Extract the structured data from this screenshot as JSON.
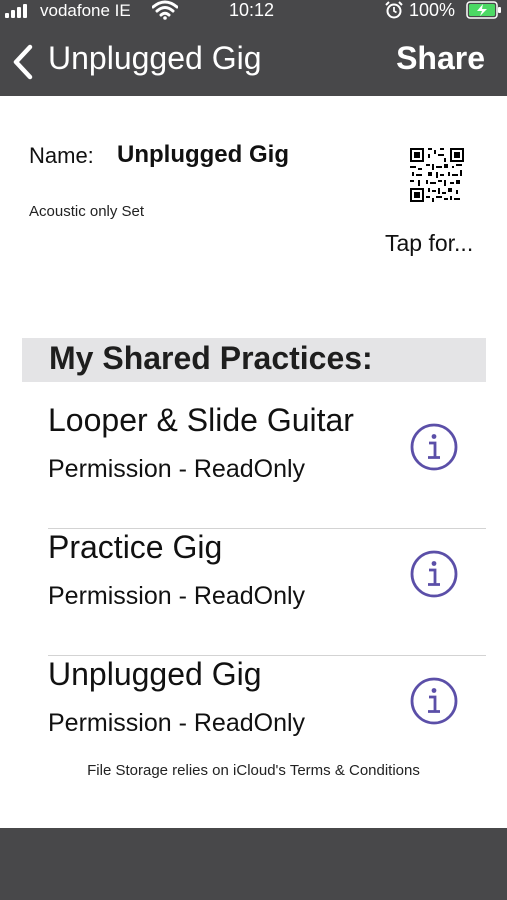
{
  "status_bar": {
    "carrier": "vodafone IE",
    "time": "10:12",
    "battery_percent": "100%",
    "icons": [
      "signal-bars-icon",
      "wifi-icon",
      "alarm-icon",
      "battery-charging-icon"
    ]
  },
  "nav": {
    "back_icon": "chevron-left-icon",
    "title": "Unplugged Gig",
    "share_label": "Share"
  },
  "info": {
    "name_label": "Name:",
    "name_value": "Unplugged Gig",
    "description": "Acoustic only Set",
    "qr_caption": "Tap for..."
  },
  "shared": {
    "title": "My Shared Practices:",
    "items": [
      {
        "title": "Looper & Slide Guitar",
        "permission": "Permission - ReadOnly"
      },
      {
        "title": "Practice Gig",
        "permission": "Permission - ReadOnly"
      },
      {
        "title": "Unplugged Gig",
        "permission": "Permission - ReadOnly"
      }
    ]
  },
  "footer": {
    "note": "File Storage relies on iCloud's Terms & Conditions"
  },
  "colors": {
    "bar": "#48484a",
    "section_header": "#e4e4e6",
    "info_icon": "#5b4fa8",
    "battery_fill": "#4cd964"
  }
}
